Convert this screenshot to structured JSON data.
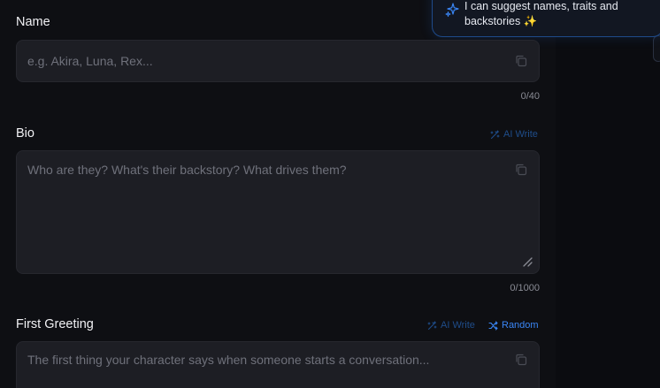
{
  "assistant": {
    "message": "I can suggest names, traits and backstories ✨",
    "accent": "#3a86f5"
  },
  "fields": {
    "name": {
      "label": "Name",
      "placeholder": "e.g. Akira, Luna, Rex...",
      "counter": "0/40"
    },
    "bio": {
      "label": "Bio",
      "placeholder": "Who are they? What's their backstory? What drives them?",
      "counter": "0/1000",
      "ai_write_label": "AI Write"
    },
    "first_greeting": {
      "label": "First Greeting",
      "placeholder": "The first thing your character says when someone starts a conversation...",
      "ai_write_label": "AI Write",
      "random_label": "Random"
    }
  },
  "colors": {
    "background": "#0e0f13",
    "field_bg": "#1d1e24",
    "accent_dim": "#1f4d8a",
    "accent": "#3a86f5"
  }
}
